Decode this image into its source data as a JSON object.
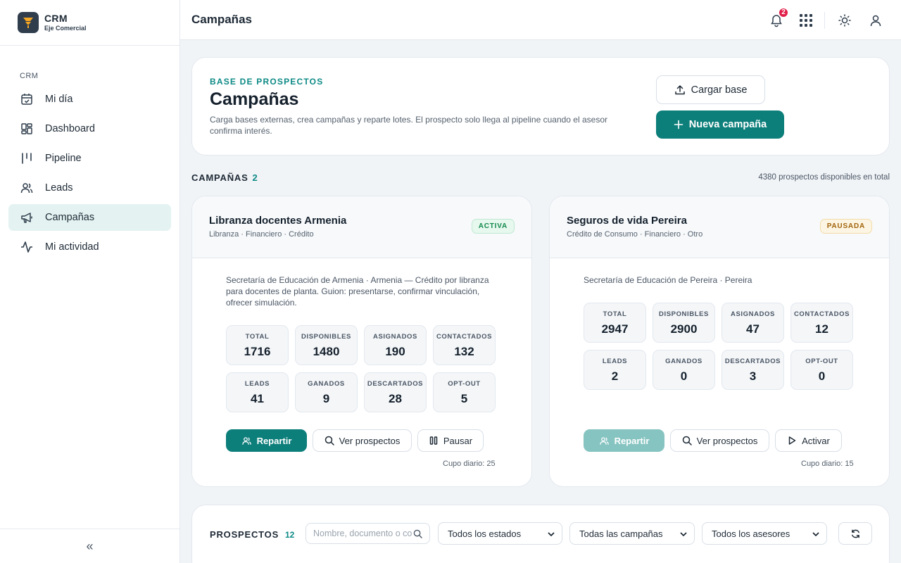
{
  "brand": {
    "title": "CRM",
    "subtitle": "Eje Comercial"
  },
  "sidebar": {
    "section_label": "CRM",
    "items": [
      {
        "label": "Mi día",
        "icon": "calendar-check-icon",
        "active": false
      },
      {
        "label": "Dashboard",
        "icon": "dashboard-grid-icon",
        "active": false
      },
      {
        "label": "Pipeline",
        "icon": "pipeline-columns-icon",
        "active": false
      },
      {
        "label": "Leads",
        "icon": "users-icon",
        "active": false
      },
      {
        "label": "Campañas",
        "icon": "megaphone-icon",
        "active": true
      },
      {
        "label": "Mi actividad",
        "icon": "activity-icon",
        "active": false
      }
    ],
    "collapse_label": "«"
  },
  "header": {
    "title": "Campañas",
    "notification_count": "2"
  },
  "hero": {
    "eyebrow": "BASE DE PROSPECTOS",
    "title": "Campañas",
    "description": "Carga bases externas, crea campañas y reparte lotes. El prospecto solo llega al pipeline cuando el asesor confirma interés.",
    "upload_label": "Cargar base",
    "new_label": "Nueva campaña"
  },
  "campaigns_section": {
    "label": "CAMPAÑAS",
    "count": "2",
    "total_note": "4380 prospectos disponibles en total"
  },
  "campaigns": [
    {
      "name": "Libranza docentes Armenia",
      "tags": "Libranza · Financiero · Crédito",
      "status": "ACTIVA",
      "entity": "Secretaría de Educación de Armenia · Armenia",
      "description": " — Crédito por libranza para docentes de planta. Guion: presentarse, confirmar vinculación, ofrecer simulación.",
      "stats": [
        {
          "label": "TOTAL",
          "value": "1716"
        },
        {
          "label": "DISPONIBLES",
          "value": "1480"
        },
        {
          "label": "ASIGNADOS",
          "value": "190"
        },
        {
          "label": "CONTACTADOS",
          "value": "132"
        },
        {
          "label": "LEADS",
          "value": "41"
        },
        {
          "label": "GANADOS",
          "value": "9"
        },
        {
          "label": "DESCARTADOS",
          "value": "28"
        },
        {
          "label": "OPT-OUT",
          "value": "5"
        }
      ],
      "actions": {
        "distribute": "Repartir",
        "view": "Ver prospectos",
        "toggle": "Pausar"
      },
      "quota": "Cupo diario: 25"
    },
    {
      "name": "Seguros de vida Pereira",
      "tags": "Crédito de Consumo · Financiero · Otro",
      "status": "PAUSADA",
      "entity": "Secretaría de Educación de Pereira · Pereira",
      "description": "",
      "stats": [
        {
          "label": "TOTAL",
          "value": "2947"
        },
        {
          "label": "DISPONIBLES",
          "value": "2900"
        },
        {
          "label": "ASIGNADOS",
          "value": "47"
        },
        {
          "label": "CONTACTADOS",
          "value": "12"
        },
        {
          "label": "LEADS",
          "value": "2"
        },
        {
          "label": "GANADOS",
          "value": "0"
        },
        {
          "label": "DESCARTADOS",
          "value": "3"
        },
        {
          "label": "OPT-OUT",
          "value": "0"
        }
      ],
      "actions": {
        "distribute": "Repartir",
        "view": "Ver prospectos",
        "toggle": "Activar"
      },
      "quota": "Cupo diario: 15"
    }
  ],
  "prospects": {
    "label": "PROSPECTOS",
    "count": "12",
    "search_placeholder": "Nombre, documento o correo",
    "filter_status": "Todos los estados",
    "filter_campaign": "Todas las campañas",
    "filter_advisor": "Todos los asesores"
  },
  "colors": {
    "accent": "#0d7f7b",
    "badge": "#e11d48",
    "active_status": "#128a4b",
    "paused_status": "#a0640a"
  }
}
